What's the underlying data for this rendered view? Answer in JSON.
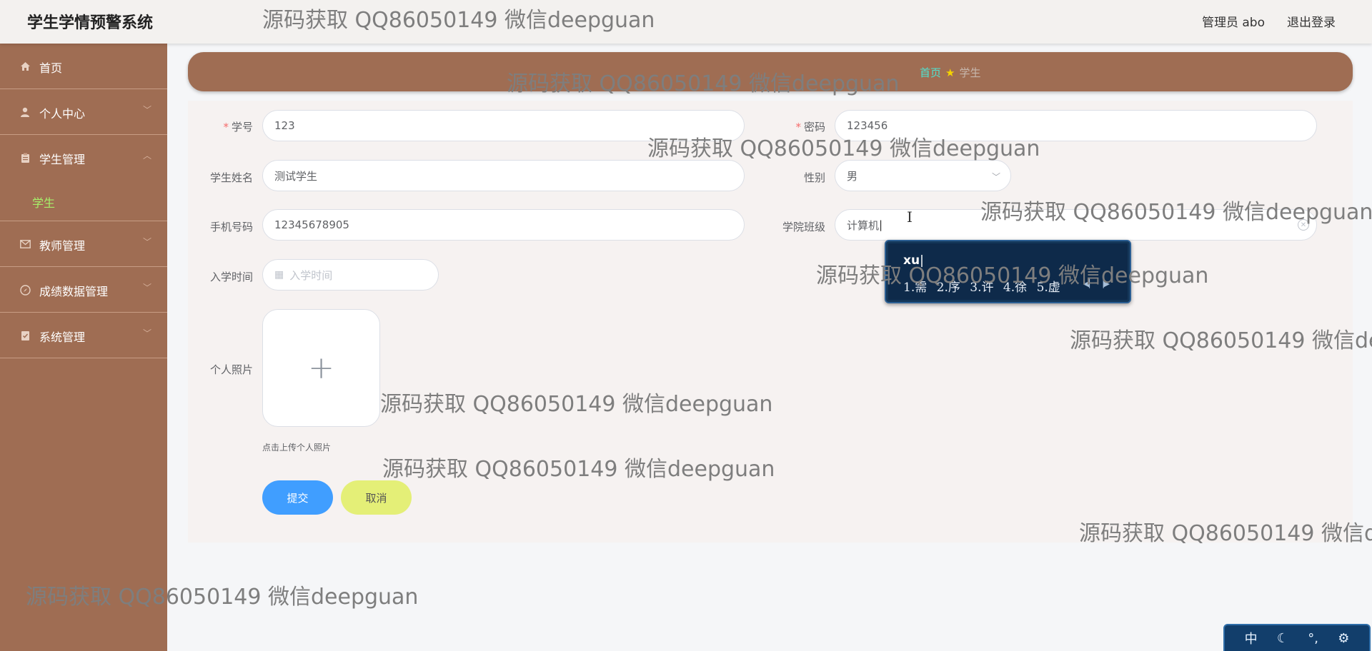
{
  "header": {
    "app_title": "学生学情预警系统",
    "user_label": "管理员 abo",
    "logout_label": "退出登录"
  },
  "sidebar": {
    "items": [
      {
        "label": "首页",
        "icon": "home-icon"
      },
      {
        "label": "个人中心",
        "icon": "user-icon"
      },
      {
        "label": "学生管理",
        "icon": "clipboard-icon",
        "sub": "学生"
      },
      {
        "label": "教师管理",
        "icon": "mail-icon"
      },
      {
        "label": "成绩数据管理",
        "icon": "compass-icon"
      },
      {
        "label": "系统管理",
        "icon": "checklist-icon"
      }
    ]
  },
  "breadcrumb": {
    "home": "首页",
    "current": "学生"
  },
  "form": {
    "student_no": {
      "label": "学号",
      "value": "123"
    },
    "password": {
      "label": "密码",
      "value": "123456"
    },
    "student_name": {
      "label": "学生姓名",
      "value": "测试学生"
    },
    "gender": {
      "label": "性别",
      "value": "男"
    },
    "phone": {
      "label": "手机号码",
      "value": "12345678905"
    },
    "college_class": {
      "label": "学院班级",
      "value": "计算机"
    },
    "enroll_time": {
      "label": "入学时间",
      "placeholder": "入学时间"
    },
    "photo": {
      "label": "个人照片",
      "tip": "点击上传个人照片"
    },
    "submit_label": "提交",
    "cancel_label": "取消"
  },
  "ime": {
    "composition": "xu",
    "candidates": [
      "1.需",
      "2.序",
      "3.许",
      "4.徐",
      "5.虚"
    ],
    "status_bar": [
      "中",
      "☾",
      "°,",
      "⚙"
    ]
  },
  "watermark_text": "源码获取 QQ86050149 微信deepguan",
  "colors": {
    "sidebar": "#9f6d53",
    "active_menu": "#a6f06a",
    "submit": "#409eff",
    "cancel": "#e4ef77",
    "required": "#f56c6c"
  }
}
